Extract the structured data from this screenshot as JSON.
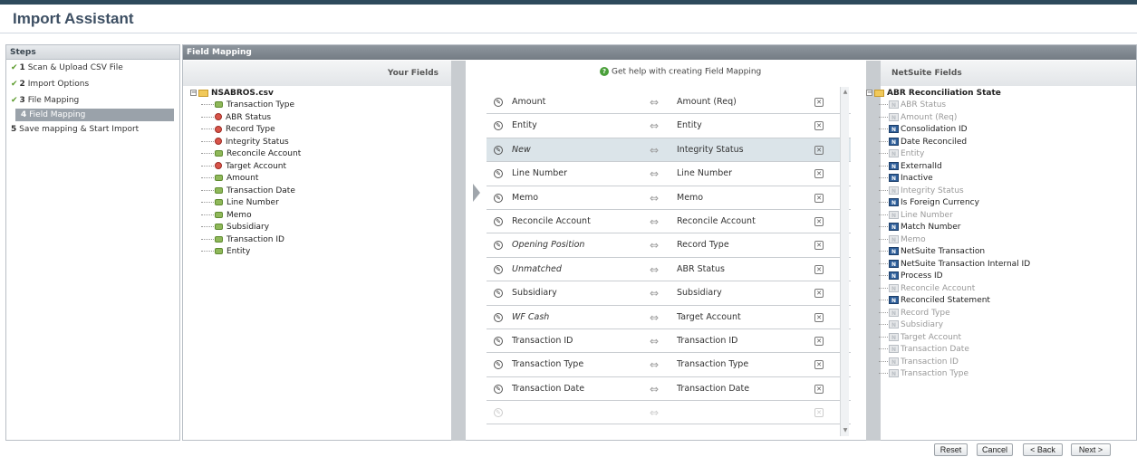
{
  "title": "Import Assistant",
  "steps": {
    "header": "Steps",
    "items": [
      {
        "num": "1",
        "label": "Scan & Upload CSV File",
        "done": "✔"
      },
      {
        "num": "2",
        "label": "Import Options",
        "done": "✔"
      },
      {
        "num": "3",
        "label": "File Mapping",
        "done": "✔"
      },
      {
        "num": "4",
        "label": "Field Mapping",
        "active": true
      },
      {
        "num": "5",
        "label": "Save mapping & Start Import"
      }
    ]
  },
  "field_mapping": {
    "header": "Field Mapping",
    "your_fields_header": "Your Fields",
    "netsuite_fields_header": "NetSuite Fields",
    "help_text": "Get help with creating Field Mapping"
  },
  "your_fields": {
    "root": "NSABROS.csv",
    "items": [
      {
        "label": "Transaction Type",
        "icon": "green"
      },
      {
        "label": "ABR Status",
        "icon": "red"
      },
      {
        "label": "Record Type",
        "icon": "red"
      },
      {
        "label": "Integrity Status",
        "icon": "red"
      },
      {
        "label": "Reconcile Account",
        "icon": "green"
      },
      {
        "label": "Target Account",
        "icon": "red"
      },
      {
        "label": "Amount",
        "icon": "green"
      },
      {
        "label": "Transaction Date",
        "icon": "green"
      },
      {
        "label": "Line Number",
        "icon": "green"
      },
      {
        "label": "Memo",
        "icon": "green"
      },
      {
        "label": "Subsidiary",
        "icon": "green"
      },
      {
        "label": "Transaction ID",
        "icon": "green"
      },
      {
        "label": "Entity",
        "icon": "green"
      }
    ]
  },
  "mappings": [
    {
      "src": "Amount",
      "dst": "Amount (Req)",
      "italic": false
    },
    {
      "src": "Entity",
      "dst": "Entity",
      "italic": false
    },
    {
      "src": "New",
      "dst": "Integrity Status",
      "italic": true,
      "selected": true
    },
    {
      "src": "Line Number",
      "dst": "Line Number",
      "italic": false
    },
    {
      "src": "Memo",
      "dst": "Memo",
      "italic": false
    },
    {
      "src": "Reconcile Account",
      "dst": "Reconcile Account",
      "italic": false
    },
    {
      "src": "Opening Position",
      "dst": "Record Type",
      "italic": true
    },
    {
      "src": "Unmatched",
      "dst": "ABR Status",
      "italic": true
    },
    {
      "src": "Subsidiary",
      "dst": "Subsidiary",
      "italic": false
    },
    {
      "src": "WF Cash",
      "dst": "Target Account",
      "italic": true
    },
    {
      "src": "Transaction ID",
      "dst": "Transaction ID",
      "italic": false
    },
    {
      "src": "Transaction Type",
      "dst": "Transaction Type",
      "italic": false
    },
    {
      "src": "Transaction Date",
      "dst": "Transaction Date",
      "italic": false
    },
    {
      "src": "",
      "dst": "",
      "empty": true
    }
  ],
  "netsuite_fields": {
    "root": "ABR Reconciliation State",
    "items": [
      {
        "label": "ABR Status",
        "used": true
      },
      {
        "label": "Amount (Req)",
        "used": true
      },
      {
        "label": "Consolidation ID",
        "used": false
      },
      {
        "label": "Date Reconciled",
        "used": false
      },
      {
        "label": "Entity",
        "used": true
      },
      {
        "label": "ExternalId",
        "used": false
      },
      {
        "label": "Inactive",
        "used": false
      },
      {
        "label": "Integrity Status",
        "used": true
      },
      {
        "label": "Is Foreign Currency",
        "used": false
      },
      {
        "label": "Line Number",
        "used": true
      },
      {
        "label": "Match Number",
        "used": false
      },
      {
        "label": "Memo",
        "used": true
      },
      {
        "label": "NetSuite Transaction",
        "used": false
      },
      {
        "label": "NetSuite Transaction Internal ID",
        "used": false
      },
      {
        "label": "Process ID",
        "used": false
      },
      {
        "label": "Reconcile Account",
        "used": true
      },
      {
        "label": "Reconciled Statement",
        "used": false
      },
      {
        "label": "Record Type",
        "used": true
      },
      {
        "label": "Subsidiary",
        "used": true
      },
      {
        "label": "Target Account",
        "used": true
      },
      {
        "label": "Transaction Date",
        "used": true
      },
      {
        "label": "Transaction ID",
        "used": true
      },
      {
        "label": "Transaction Type",
        "used": true
      }
    ]
  },
  "buttons": {
    "reset": "Reset",
    "cancel": "Cancel",
    "back": "< Back",
    "next": "Next >"
  },
  "colors": {
    "header_bar": "#2e4a5c",
    "title": "#3d4f63",
    "selected_row": "#dbe4e9",
    "active_step": "#9aa2aa",
    "check": "#5a9a2a"
  }
}
